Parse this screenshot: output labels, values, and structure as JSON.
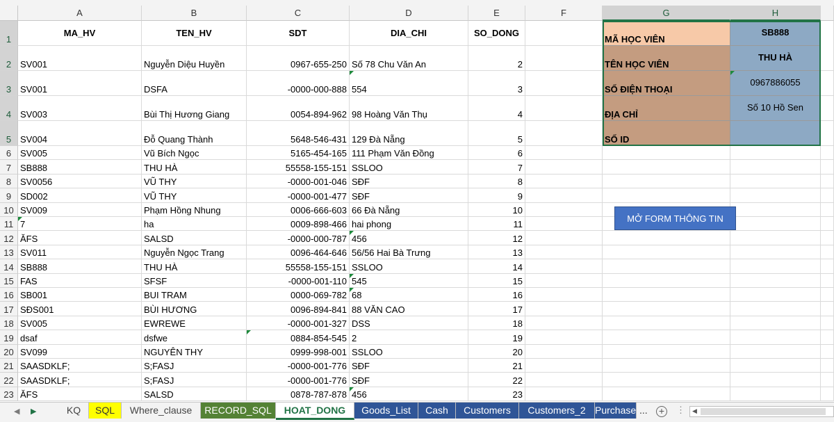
{
  "columns": [
    "A",
    "B",
    "C",
    "D",
    "E",
    "F",
    "G",
    "H"
  ],
  "header_row": {
    "row": "1",
    "cells": [
      "MA_HV",
      "TEN_HV",
      "SDT",
      "DIA_CHI",
      "SO_DONG"
    ]
  },
  "rows": [
    {
      "row": "2",
      "ma": "SV001",
      "ten": "Nguyễn Diệu Huyền",
      "sdt": "0967-655-250",
      "dc": "Số 78 Chu Văn An",
      "so": "2"
    },
    {
      "row": "3",
      "ma": "SV001",
      "ten": "DSFA",
      "sdt": "-0000-000-888",
      "dc": "554",
      "so": "3"
    },
    {
      "row": "4",
      "ma": "SV003",
      "ten": "Bùi Thị Hương Giang",
      "sdt": "0054-894-962",
      "dc": "98 Hoàng Văn Thụ",
      "so": "4"
    },
    {
      "row": "5",
      "ma": "SV004",
      "ten": "Đỗ Quang Thành",
      "sdt": "5648-546-431",
      "dc": "129 Đà Nẵng",
      "so": "5"
    },
    {
      "row": "6",
      "ma": "SV005",
      "ten": "Vũ Bích Ngọc",
      "sdt": "5165-454-165",
      "dc": "111 Phạm Văn Đồng",
      "so": "6"
    },
    {
      "row": "7",
      "ma": "SB888",
      "ten": "THU HÀ",
      "sdt": "55558-155-151",
      "dc": "SSLOO",
      "so": "7"
    },
    {
      "row": "8",
      "ma": "SV0056",
      "ten": "VŨ THY",
      "sdt": "-0000-001-046",
      "dc": "SĐF",
      "so": "8"
    },
    {
      "row": "9",
      "ma": "SD002",
      "ten": "VŨ THY",
      "sdt": "-0000-001-477",
      "dc": "SĐF",
      "so": "9"
    },
    {
      "row": "10",
      "ma": "SV009",
      "ten": "Phạm Hồng Nhung",
      "sdt": "0006-666-603",
      "dc": "66 Đà Nẵng",
      "so": "10"
    },
    {
      "row": "11",
      "ma": "7",
      "ten": "ha",
      "sdt": "0009-898-466",
      "dc": "hai phong",
      "so": "11"
    },
    {
      "row": "12",
      "ma": "ĂFS",
      "ten": "SALSD",
      "sdt": "-0000-000-787",
      "dc": "456",
      "so": "12"
    },
    {
      "row": "13",
      "ma": " SV011",
      "ten": " Nguyễn Ngọc Trang",
      "sdt": "0096-464-646",
      "dc": " 56/56 Hai Bà Trưng",
      "so": "13"
    },
    {
      "row": "14",
      "ma": "SB888",
      "ten": "THU HÀ",
      "sdt": "55558-155-151",
      "dc": "SSLOO",
      "so": "14"
    },
    {
      "row": "15",
      "ma": "FAS",
      "ten": "SFSF",
      "sdt": "-0000-001-110",
      "dc": "545",
      "so": "15"
    },
    {
      "row": "16",
      "ma": " SB001",
      "ten": " BUI TRAM",
      "sdt": "0000-069-782",
      "dc": "68",
      "so": "16"
    },
    {
      "row": "17",
      "ma": " SĐS001",
      "ten": " BÙI HƯƠNG",
      "sdt": "0096-894-841",
      "dc": " 88 VĂN CAO",
      "so": "17"
    },
    {
      "row": "18",
      "ma": "SV005",
      "ten": "EWREWE",
      "sdt": "-0000-001-327",
      "dc": "DSS",
      "so": "18"
    },
    {
      "row": "19",
      "ma": " dsaf",
      "ten": " dsfwe",
      "sdt": "0884-854-545",
      "dc": "2",
      "so": "19"
    },
    {
      "row": "20",
      "ma": "SV099",
      "ten": "NGUYÊN THY",
      "sdt": "0999-998-001",
      "dc": "SSLOO",
      "so": "20"
    },
    {
      "row": "21",
      "ma": "SAASDKLF;",
      "ten": "S;FASJ",
      "sdt": "-0000-001-776",
      "dc": "SĐF",
      "so": "21"
    },
    {
      "row": "22",
      "ma": "SAASDKLF;",
      "ten": "S;FASJ",
      "sdt": "-0000-001-776",
      "dc": "SĐF",
      "so": "22"
    },
    {
      "row": "23",
      "ma": "ĂFS",
      "ten": " SALSD",
      "sdt": "0878-787-878",
      "dc": "456",
      "so": "23"
    }
  ],
  "form": {
    "items": [
      {
        "label": "MÃ HỌC VIÊN",
        "value": "SB888"
      },
      {
        "label": "TÊN HỌC VIÊN",
        "value": "THU HÀ"
      },
      {
        "label": "SỐ ĐIỆN THOẠI",
        "value": "0967886055"
      },
      {
        "label": "ĐỊA CHỈ",
        "value": "Số 10 Hồ Sen"
      },
      {
        "label": "SỐ ID",
        "value": ""
      }
    ],
    "button_label": "MỞ FORM THÔNG TIN"
  },
  "tabs": [
    {
      "label": "KQ",
      "style": "plain"
    },
    {
      "label": "SQL",
      "style": "yellow"
    },
    {
      "label": "Where_clause",
      "style": "plain"
    },
    {
      "label": "RECORD_SQL",
      "style": "green"
    },
    {
      "label": "HOAT_DONG",
      "style": "active"
    },
    {
      "label": "Goods_List",
      "style": "blue"
    },
    {
      "label": "Cash",
      "style": "blue"
    },
    {
      "label": "Customers",
      "style": "blue"
    },
    {
      "label": "Customers_2",
      "style": "blue"
    },
    {
      "label": "Purchase",
      "style": "blue"
    }
  ],
  "tab_overflow": "...",
  "colors": {
    "label_bg": "#c49c80",
    "first_label_bg": "#f7c9a8",
    "value_bg": "#8da9c4",
    "button_bg": "#4472c4",
    "active_tab": "#217346"
  }
}
